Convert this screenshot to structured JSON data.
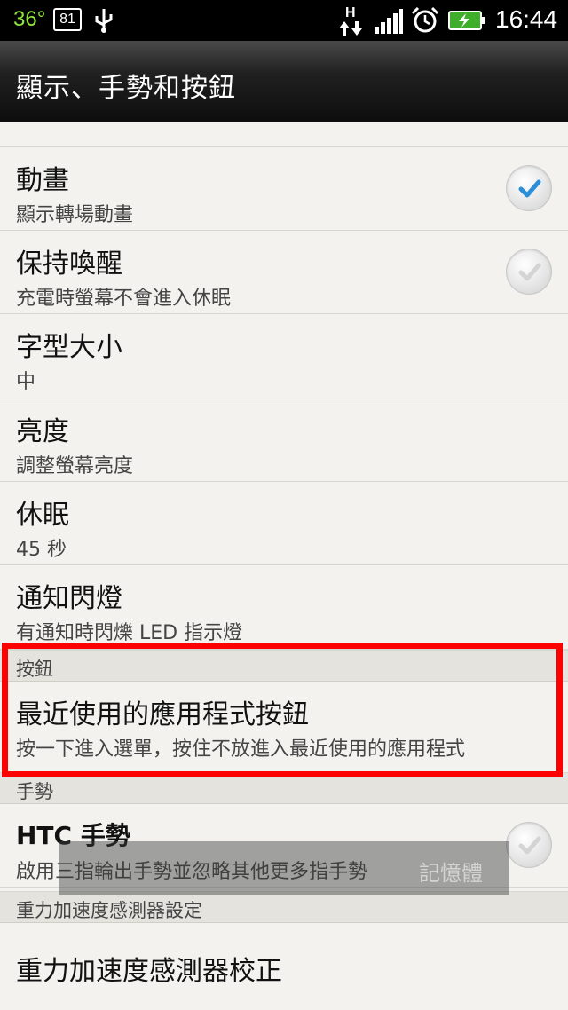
{
  "status_bar": {
    "temperature": "36°",
    "battery_percent": "81",
    "network": "H",
    "time": "16:44",
    "icons": [
      "usb-icon",
      "h-network-icon",
      "signal-icon",
      "alarm-icon",
      "battery-charging-icon"
    ]
  },
  "header": {
    "title": "顯示、手勢和按鈕"
  },
  "items": {
    "animation": {
      "title": "動畫",
      "subtitle": "顯示轉場動畫",
      "checked": true
    },
    "stay_awake": {
      "title": "保持喚醒",
      "subtitle": "充電時螢幕不會進入休眠",
      "checked": false
    },
    "font_size": {
      "title": "字型大小",
      "subtitle": "中"
    },
    "brightness": {
      "title": "亮度",
      "subtitle": "調整螢幕亮度"
    },
    "sleep": {
      "title": "休眠",
      "subtitle": "45 秒"
    },
    "notification_light": {
      "title": "通知閃燈",
      "subtitle": "有通知時閃爍 LED 指示燈"
    },
    "recent_apps_button": {
      "title": "最近使用的應用程式按鈕",
      "subtitle": "按一下進入選單，按住不放進入最近使用的應用程式"
    },
    "htc_gesture": {
      "title": "HTC 手勢",
      "subtitle": "啟用三指輪出手勢並忽略其他更多指手勢",
      "checked": false
    },
    "gsensor_calibration": {
      "title": "重力加速度感測器校正"
    }
  },
  "sections": {
    "buttons": "按鈕",
    "gestures": "手勢",
    "gsensor": "重力加速度感測器設定"
  },
  "toast": {
    "text": "記憶體"
  },
  "colors": {
    "highlight": "#ff0000",
    "check_accent": "#2b8fd8",
    "temperature": "#8fe53a"
  }
}
